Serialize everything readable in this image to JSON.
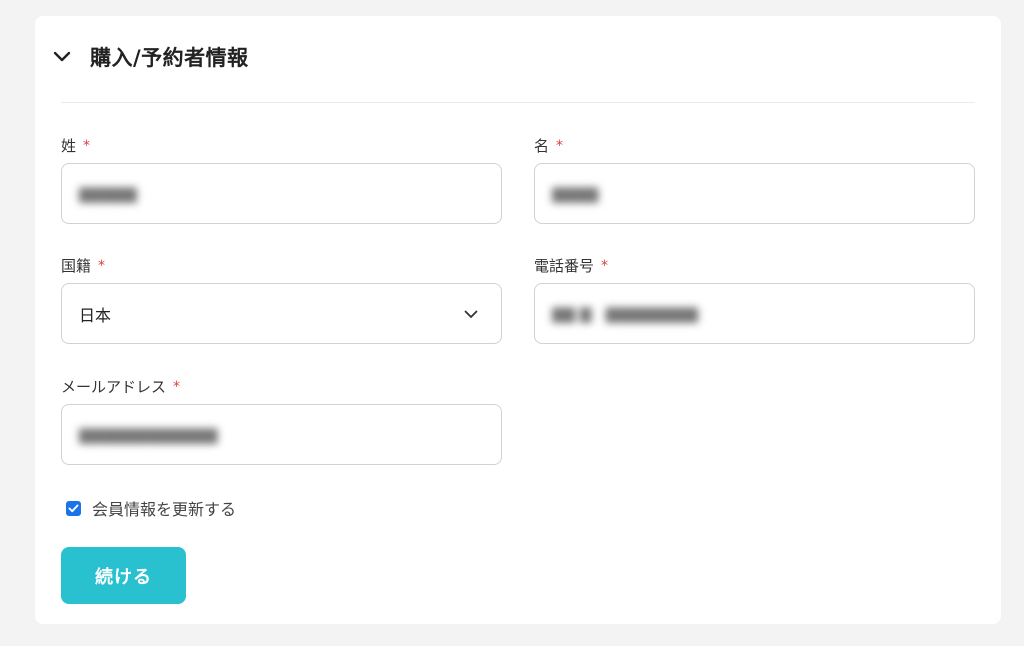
{
  "section": {
    "title": "購入/予約者情報",
    "toggle_icon": "chevron-down-icon"
  },
  "fields": {
    "last_name": {
      "label": "姓",
      "required_mark": "*",
      "value": ""
    },
    "first_name": {
      "label": "名",
      "required_mark": "*",
      "value": ""
    },
    "nationality": {
      "label": "国籍",
      "required_mark": "*",
      "value": "日本",
      "icon": "chevron-down-icon"
    },
    "phone": {
      "label": "電話番号",
      "required_mark": "*",
      "value": ""
    },
    "email": {
      "label": "メールアドレス",
      "required_mark": "*",
      "value": ""
    }
  },
  "update_member": {
    "label": "会員情報を更新する",
    "checked": true,
    "icon": "checkmark-icon"
  },
  "continue_button": {
    "label": "続ける",
    "color": "#29c1cf"
  },
  "colors": {
    "required": "#e0413f",
    "checkbox": "#1a73e8"
  }
}
